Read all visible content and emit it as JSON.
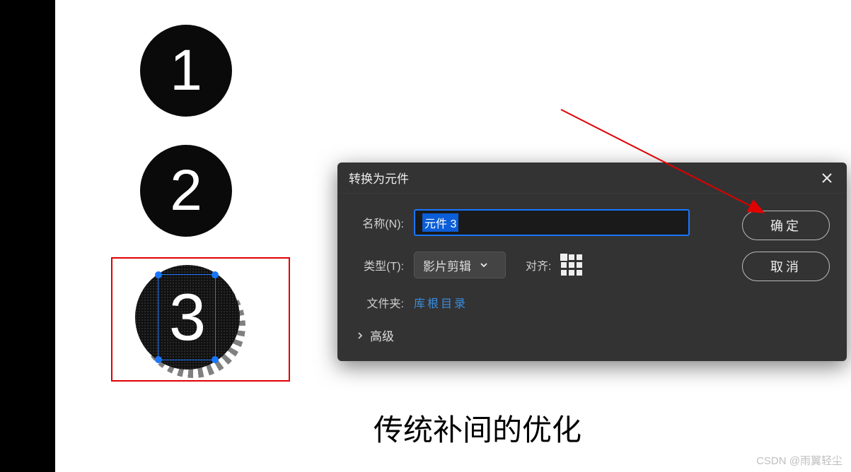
{
  "badges": {
    "one": "1",
    "two": "2",
    "three": "3"
  },
  "dialog": {
    "title": "转换为元件",
    "name_label": "名称(N):",
    "name_value": "元件 3",
    "type_label": "类型(T):",
    "type_value": "影片剪辑",
    "align_label": "对齐:",
    "folder_label": "文件夹:",
    "folder_link": "库根目录",
    "advanced_label": "高级",
    "ok_button": "确定",
    "cancel_button": "取消"
  },
  "caption": "传统补间的优化",
  "watermark": "CSDN @雨翼轻尘"
}
